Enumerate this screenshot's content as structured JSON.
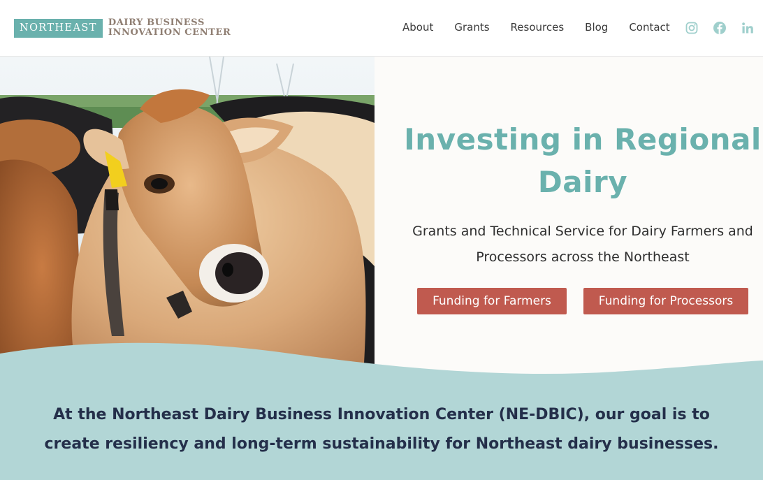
{
  "brand": {
    "logo_box": "NORTHEAST",
    "logo_line1": "DAIRY BUSINESS",
    "logo_line2": "INNOVATION CENTER",
    "teal": "#6ab1ad",
    "taupe": "#8f7e72"
  },
  "nav": {
    "items": [
      {
        "label": "About"
      },
      {
        "label": "Grants"
      },
      {
        "label": "Resources"
      },
      {
        "label": "Blog"
      },
      {
        "label": "Contact"
      }
    ]
  },
  "social": {
    "icons": [
      "instagram-icon",
      "facebook-icon",
      "linkedin-icon"
    ],
    "color": "#9fcfcc"
  },
  "hero": {
    "image": "jersey-cow-photo",
    "title_line1": "Investing in Regional",
    "title_line2": "Dairy",
    "subtitle_line1": "Grants and Technical Service for Dairy Farmers and",
    "subtitle_line2": "Processors across the Northeast",
    "button_farmers": "Funding for Farmers",
    "button_processors": "Funding for Processors",
    "button_color": "#c05a4f"
  },
  "mission": {
    "line1": "At the Northeast Dairy Business Innovation Center (NE-DBIC), our goal is to",
    "line2": "create resiliency and long-term sustainability for Northeast dairy businesses.",
    "band_color": "#b2d6d6",
    "text_color": "#242f4a"
  }
}
